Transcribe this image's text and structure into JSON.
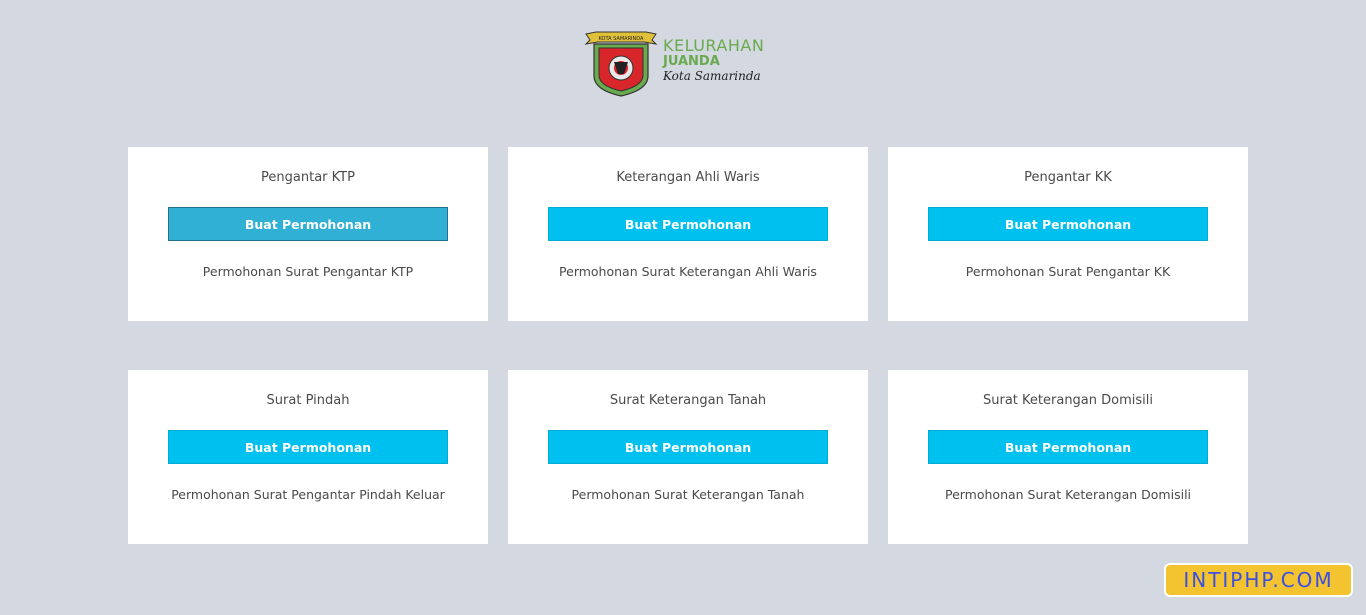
{
  "header": {
    "logo_line1": "KELURAHAN",
    "logo_line2": "JUANDA",
    "logo_line3": "Kota Samarinda",
    "emblem_text": "KOTA SAMARINDA"
  },
  "cards": [
    {
      "title": "Pengantar KTP",
      "button": "Buat Permohonan",
      "description": "Permohonan Surat Pengantar KTP"
    },
    {
      "title": "Keterangan Ahli Waris",
      "button": "Buat Permohonan",
      "description": "Permohonan Surat Keterangan Ahli Waris"
    },
    {
      "title": "Pengantar KK",
      "button": "Buat Permohonan",
      "description": "Permohonan Surat Pengantar KK"
    },
    {
      "title": "Surat Pindah",
      "button": "Buat Permohonan",
      "description": "Permohonan Surat Pengantar Pindah Keluar"
    },
    {
      "title": "Surat Keterangan Tanah",
      "button": "Buat Permohonan",
      "description": "Permohonan Surat Keterangan Tanah"
    },
    {
      "title": "Surat Keterangan Domisili",
      "button": "Buat Permohonan",
      "description": "Permohonan Surat Keterangan Domisili"
    }
  ],
  "watermark": "INTIPHP.COM",
  "colors": {
    "background": "#d3d8e1",
    "button": "#00c0ef",
    "button_active": "#31b0d5",
    "logo_green": "#6aaa4e"
  }
}
